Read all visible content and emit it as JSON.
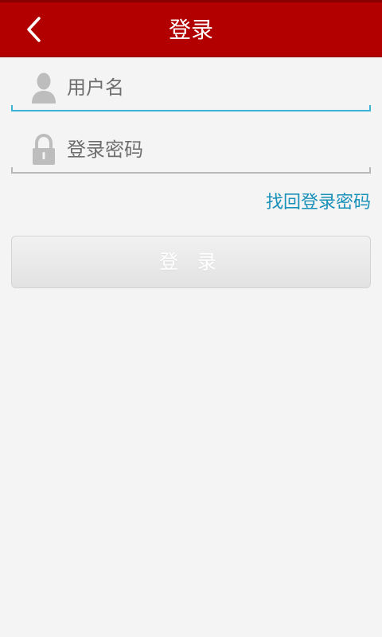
{
  "header": {
    "title": "登录",
    "back_icon": "chevron-left-icon",
    "background_color": "#b20000"
  },
  "form": {
    "username": {
      "placeholder": "用户名",
      "icon": "user-icon"
    },
    "password": {
      "placeholder": "登录密码",
      "icon": "lock-icon"
    },
    "forgot_password_label": "找回登录密码",
    "login_button_label": "登 录"
  },
  "colors": {
    "accent_link": "#1990b8",
    "active_field_underline": "#3bb3d5",
    "page_background": "#f4f4f4"
  }
}
